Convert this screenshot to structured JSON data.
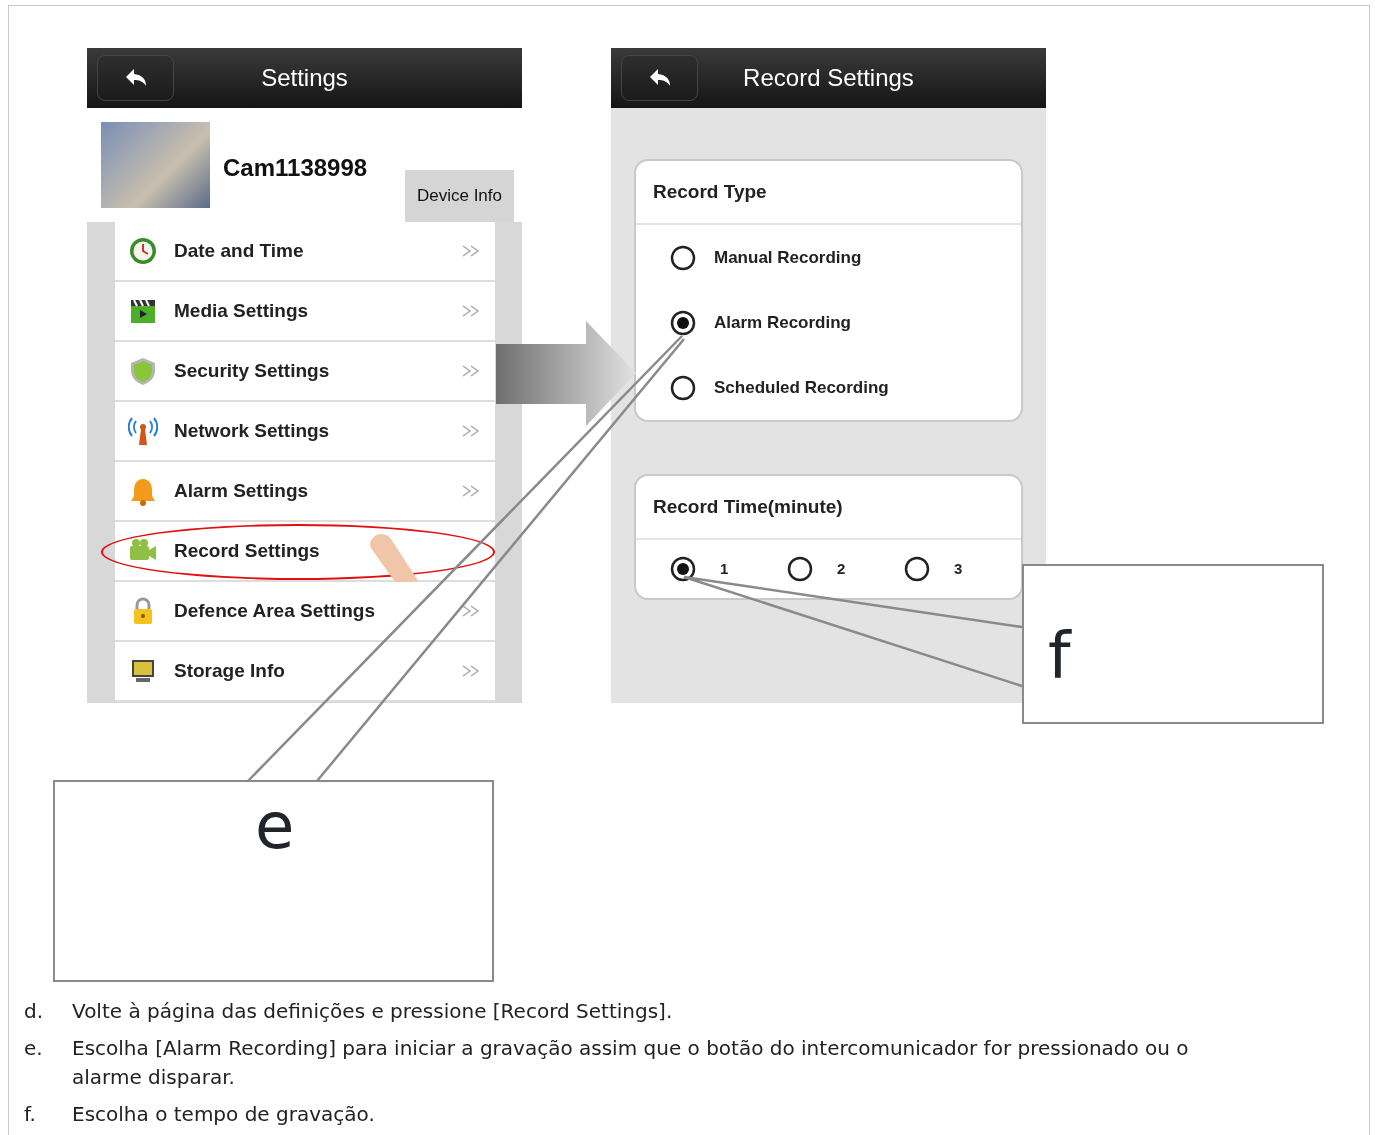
{
  "settings_screen": {
    "title": "Settings",
    "camera_name": "Cam1138998",
    "device_info_button": "Device Info",
    "items": [
      {
        "label": "Date and Time",
        "kind": "clock",
        "highlighted": false,
        "chevron": true
      },
      {
        "label": "Media Settings",
        "kind": "clapper",
        "highlighted": false,
        "chevron": true
      },
      {
        "label": "Security Settings",
        "kind": "shield",
        "highlighted": false,
        "chevron": true
      },
      {
        "label": "Network Settings",
        "kind": "antenna",
        "highlighted": false,
        "chevron": true
      },
      {
        "label": "Alarm Settings",
        "kind": "bell",
        "highlighted": false,
        "chevron": true
      },
      {
        "label": "Record Settings",
        "kind": "camera",
        "highlighted": true,
        "chevron": false
      },
      {
        "label": "Defence Area Settings",
        "kind": "lock",
        "highlighted": false,
        "chevron": true
      },
      {
        "label": "Storage Info",
        "kind": "monitor",
        "highlighted": false,
        "chevron": true
      }
    ]
  },
  "record_screen": {
    "title": "Record Settings",
    "record_type": {
      "heading": "Record Type",
      "options": [
        {
          "label": "Manual Recording",
          "selected": false
        },
        {
          "label": "Alarm Recording",
          "selected": true
        },
        {
          "label": "Scheduled Recording",
          "selected": false
        }
      ]
    },
    "record_time": {
      "heading": "Record Time(minute)",
      "options": [
        {
          "label": "1",
          "selected": true
        },
        {
          "label": "2",
          "selected": false
        },
        {
          "label": "3",
          "selected": false
        }
      ]
    }
  },
  "callouts": [
    {
      "label": "e"
    },
    {
      "label": "f"
    }
  ],
  "steps": [
    {
      "marker": "d.",
      "text": "Volte à página das definições e pressione [Record Settings]."
    },
    {
      "marker": "e.",
      "text": "Escolha [Alarm Recording] para iniciar a gravação assim que o botão do intercomunicador for pressionado ou o alarme disparar."
    },
    {
      "marker": "f.",
      "text": "Escolha o tempo de gravação."
    }
  ]
}
